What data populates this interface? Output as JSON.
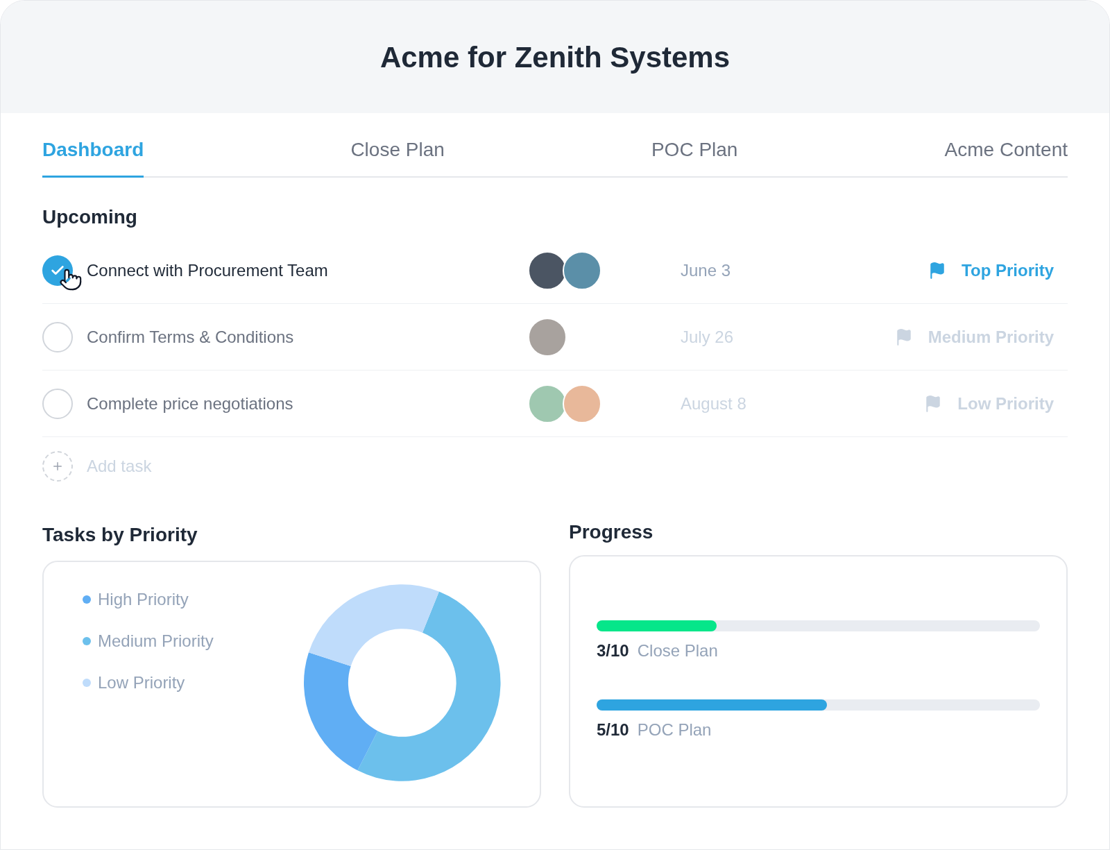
{
  "header": {
    "title": "Acme for Zenith Systems"
  },
  "tabs": [
    {
      "label": "Dashboard",
      "selected": true
    },
    {
      "label": "Close Plan",
      "selected": false
    },
    {
      "label": "POC Plan",
      "selected": false
    },
    {
      "label": "Acme Content",
      "selected": false
    }
  ],
  "upcoming": {
    "title": "Upcoming",
    "tasks": [
      {
        "title": "Connect with Procurement Team",
        "checked": true,
        "avatars": [
          {
            "color": "#4b5563"
          },
          {
            "color": "#5b8fa8"
          }
        ],
        "date": "June 3",
        "kind": "top",
        "priority_label": "Top Priority"
      },
      {
        "title": "Confirm Terms & Conditions",
        "checked": false,
        "avatars": [
          {
            "color": "#a8a29e"
          }
        ],
        "date": "July 26",
        "kind": "medium",
        "priority_label": "Medium Priority"
      },
      {
        "title": "Complete price negotiations",
        "checked": false,
        "avatars": [
          {
            "color": "#9fc8b0"
          },
          {
            "color": "#e8b89a"
          }
        ],
        "date": "August 8",
        "kind": "low",
        "priority_label": "Low Priority"
      }
    ],
    "add_task": "Add task"
  },
  "tasks_by_priority": {
    "title": "Tasks by Priority",
    "legend": [
      {
        "label": "High Priority",
        "color": "#60aef4"
      },
      {
        "label": "Medium Priority",
        "color": "#6cc0ec"
      },
      {
        "label": "Low Priority",
        "color": "#bfdcfb"
      }
    ]
  },
  "progress": {
    "title": "Progress",
    "items": [
      {
        "count": "3/10",
        "label": "Close Plan",
        "level": 0.27,
        "color": "#06e68a"
      },
      {
        "count": "5/10",
        "label": "POC Plan",
        "level": 0.52,
        "color": "#2ea4e0"
      }
    ]
  }
}
